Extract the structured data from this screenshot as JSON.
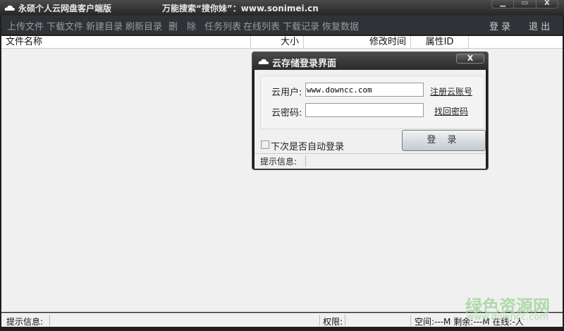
{
  "app": {
    "title": "永硕个人云网盘客户端版",
    "slogan": "万能搜索“搜你妹”：www.sonimei.cn",
    "window_controls": [
      "▁",
      "▭",
      "X"
    ]
  },
  "toolbar": {
    "items": [
      "上传文件",
      "下载文件",
      "新建目录",
      "刷新目录",
      "删　除",
      "任务列表",
      "在线列表",
      "下载记录",
      "恢复数据"
    ],
    "login": "登 录",
    "logout": "退 出"
  },
  "columns": [
    "文件名称",
    "大小",
    "修改时间",
    "属性ID"
  ],
  "status": {
    "info_label": "提示信息:",
    "perm_label": "权限:",
    "space": "空间:---M 剩余:---M 在线:-人"
  },
  "watermark": {
    "name": "绿色资源网",
    "url": "www.downcc.com"
  },
  "dialog": {
    "title": "云存储登录界面",
    "close": "X",
    "user_label": "云用户:",
    "user_value": "www.downcc.com",
    "pass_label": "云密码:",
    "pass_value": "",
    "register": "注册云账号",
    "recover": "找回密码",
    "auto_login": "下次是否自动登录",
    "login_button": "登 录",
    "info_label": "提示信息:"
  }
}
